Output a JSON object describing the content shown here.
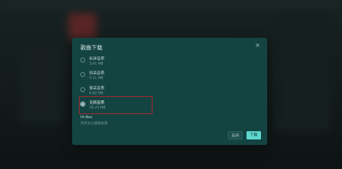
{
  "dialog": {
    "title": "歌曲下载",
    "close_icon": "close-icon"
  },
  "options": [
    {
      "label": "标准音质",
      "size": "3.61 MB",
      "selected": false
    },
    {
      "label": "较高音质",
      "size": "5.11 MB",
      "selected": false
    },
    {
      "label": "极高音质",
      "size": "6.82 MB",
      "selected": false
    },
    {
      "label": "无损音质",
      "size": "26.23 MB",
      "selected": true
    }
  ],
  "hires": {
    "label": "Hi-Res",
    "desc": "文件大小获取失败"
  },
  "buttons": {
    "cancel": "关闭",
    "download": "下载"
  }
}
